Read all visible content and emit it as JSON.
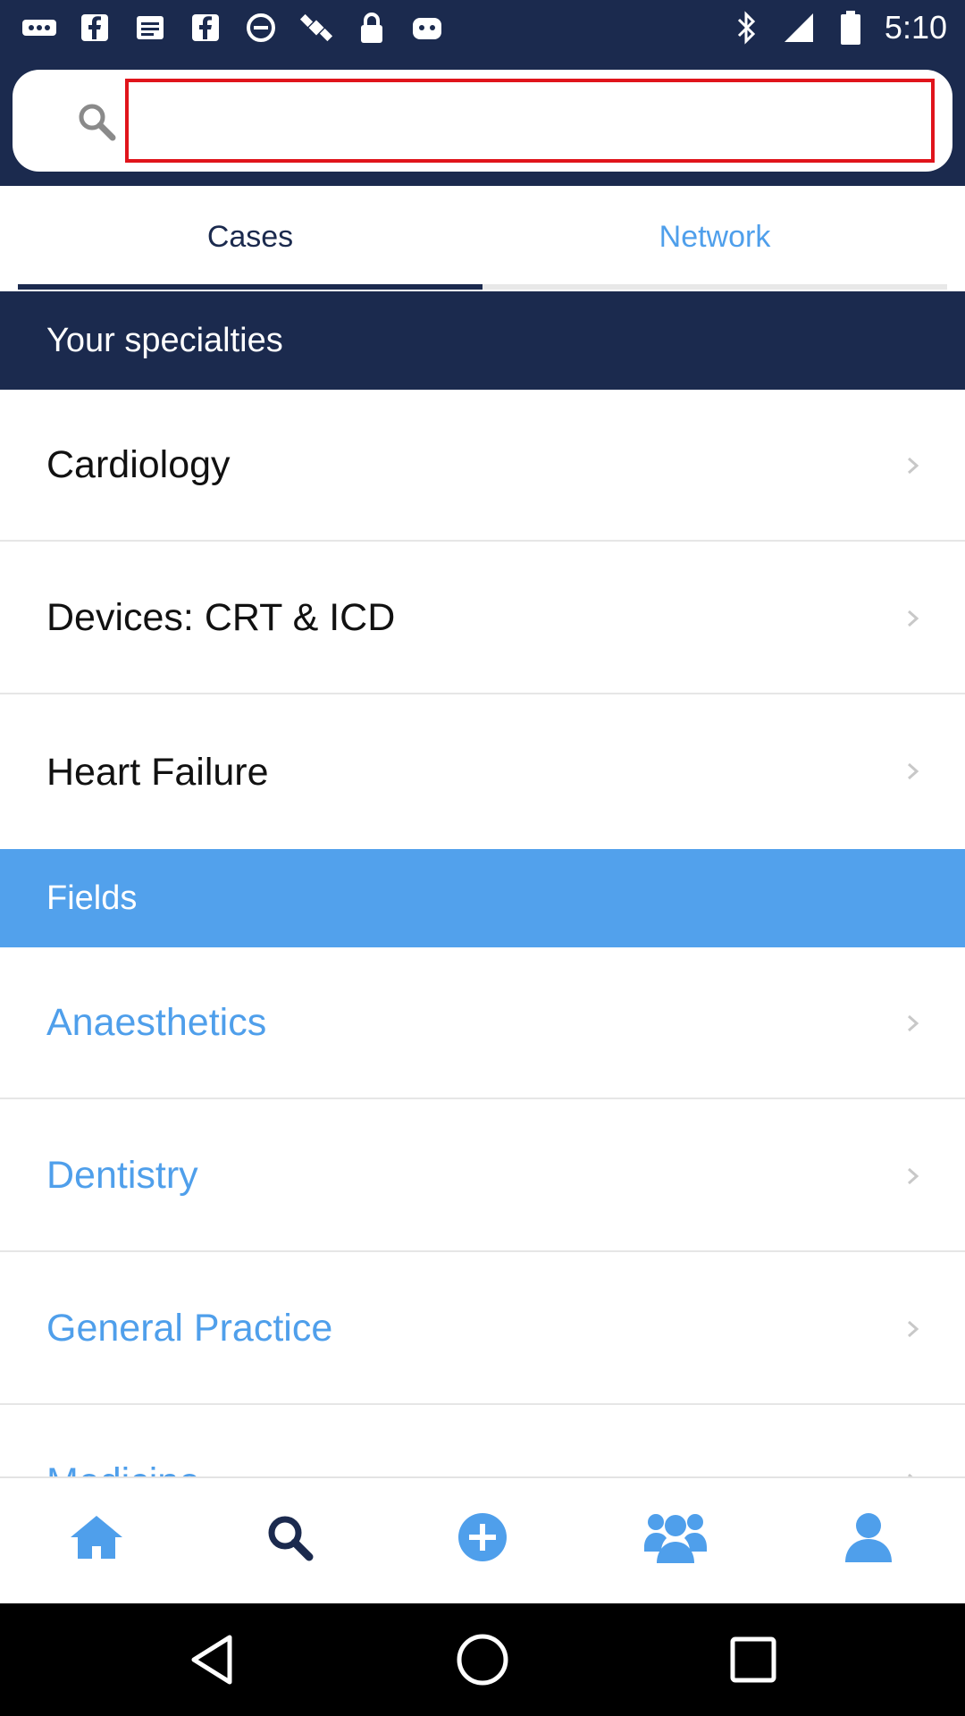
{
  "status_bar": {
    "time": "5:10",
    "left_icons": [
      "more-icon",
      "facebook-icon",
      "notes-icon",
      "facebook-icon",
      "blocked-icon",
      "satellite-icon",
      "lock-icon",
      "android-icon"
    ],
    "right_icons": [
      "bluetooth-icon",
      "signal-icon",
      "battery-icon"
    ]
  },
  "search": {
    "placeholder": "",
    "value": ""
  },
  "tabs": [
    {
      "label": "Cases",
      "active": true
    },
    {
      "label": "Network",
      "active": false
    }
  ],
  "sections": {
    "specialties": {
      "title": "Your specialties",
      "items": [
        "Cardiology",
        "Devices: CRT & ICD",
        "Heart Failure"
      ]
    },
    "fields": {
      "title": "Fields",
      "items": [
        "Anaesthetics",
        "Dentistry",
        "General Practice",
        "Medicine"
      ]
    }
  },
  "bottom_nav": [
    {
      "icon": "home-icon",
      "color": "#4f9feb"
    },
    {
      "icon": "search-icon",
      "color": "#1b2a4e"
    },
    {
      "icon": "add-circle-icon",
      "color": "#4f9feb"
    },
    {
      "icon": "group-icon",
      "color": "#4f9feb"
    },
    {
      "icon": "profile-icon",
      "color": "#4f9feb"
    }
  ],
  "colors": {
    "navy": "#1b2a4e",
    "accent_blue": "#4f9feb",
    "fields_header": "#52a1ec",
    "input_border": "#e0141b"
  }
}
